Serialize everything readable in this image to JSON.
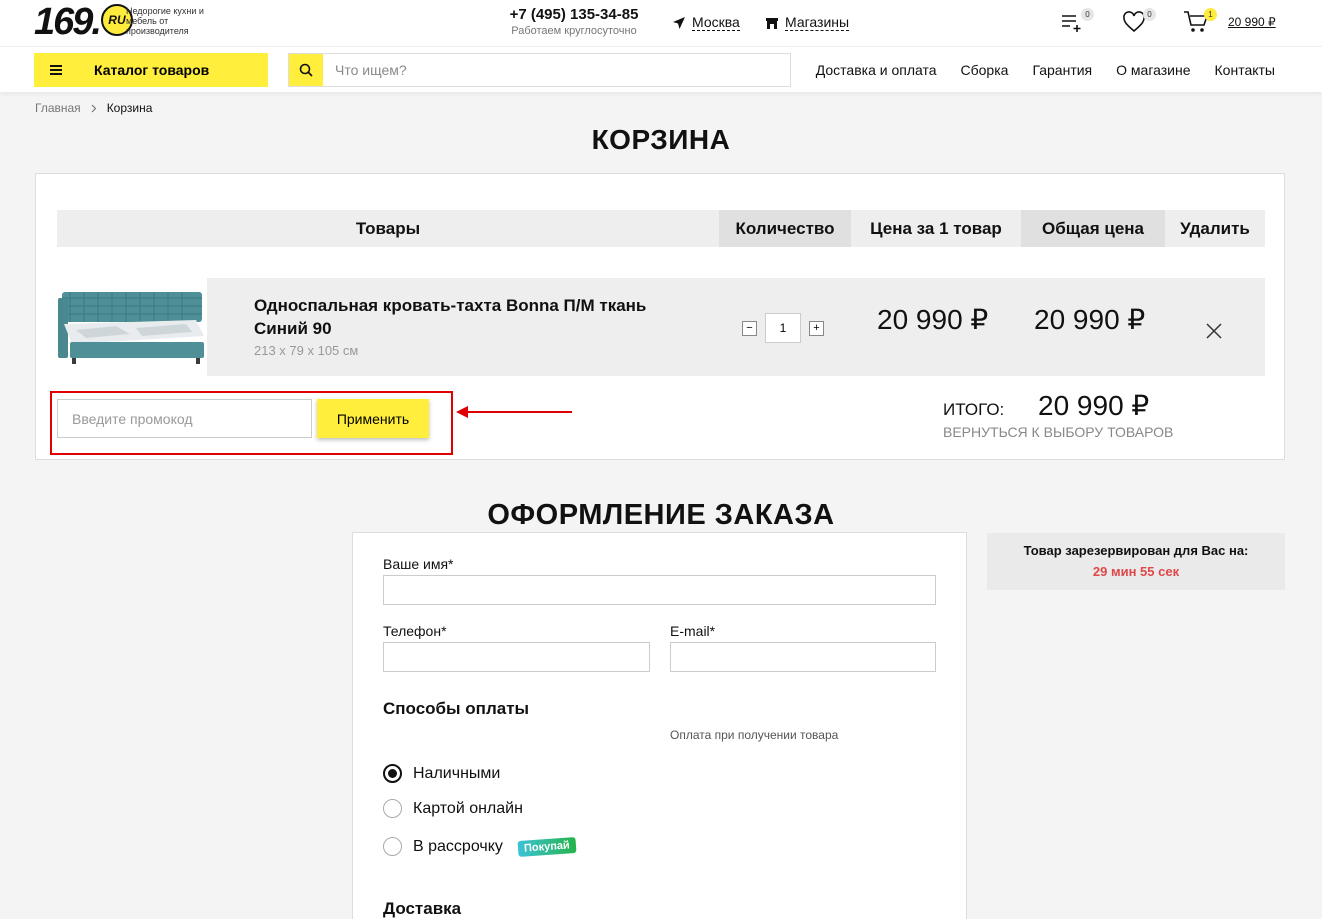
{
  "header": {
    "logo_text": "169.",
    "logo_ru": "RU",
    "logo_tagline": "Недорогие кухни и мебель от производителя",
    "phone": "+7 (495) 135-34-85",
    "phone_note": "Работаем круглосуточно",
    "city": "Москва",
    "shops": "Магазины",
    "compare_count": "0",
    "favorites_count": "0",
    "cart_count": "1",
    "cart_total": "20 990 ₽"
  },
  "nav": {
    "catalog_label": "Каталог товаров",
    "search_placeholder": "Что ищем?",
    "links": [
      "Доставка и оплата",
      "Сборка",
      "Гарантия",
      "О магазине",
      "Контакты"
    ]
  },
  "breadcrumb": [
    "Главная",
    "Корзина"
  ],
  "cart": {
    "title": "КОРЗИНА",
    "columns": [
      "Товары",
      "Количество",
      "Цена за 1 товар",
      "Общая цена",
      "Удалить"
    ],
    "item": {
      "name": "Односпальная кровать-тахта Bonna П/М ткань Синий 90",
      "dimensions": "213 x 79 x 105 см",
      "quantity": "1",
      "unit_price": "20 990 ₽",
      "total_price": "20 990 ₽"
    },
    "promo_placeholder": "Введите промокод",
    "promo_button": "Применить",
    "total_label": "ИТОГО:",
    "total_value": "20 990 ₽",
    "back_link": "ВЕРНУТЬСЯ К ВЫБОРУ ТОВАРОВ"
  },
  "order": {
    "title": "ОФОРМЛЕНИЕ ЗАКАЗА",
    "name_label": "Ваше имя*",
    "phone_label": "Телефон*",
    "email_label": "E-mail*",
    "payment_title": "Способы оплаты",
    "payment_note": "Оплата при получении товара",
    "payment_options": [
      "Наличными",
      "Картой онлайн",
      "В рассрочку"
    ],
    "pokupay_badge": "Покупай",
    "delivery_title": "Доставка"
  },
  "reserve": {
    "text": "Товар зарезервирован для Вас на:",
    "time": "29 мин 55 сек"
  },
  "colors": {
    "accent_yellow": "#ffee3b",
    "highlight_red": "#e00000",
    "timer_red": "#e04848"
  }
}
